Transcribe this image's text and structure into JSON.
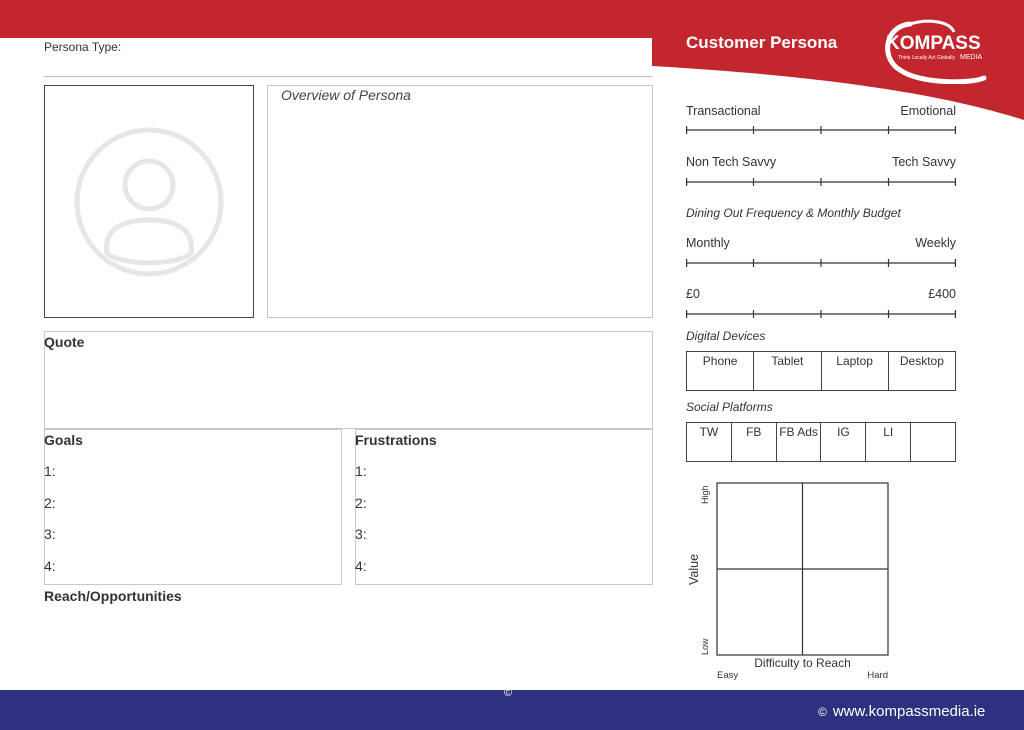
{
  "header": {
    "title": "Customer Persona",
    "logo_text": "KOMPASS",
    "logo_sub": "MEDIA",
    "logo_tagline": "Think Locally Act Globally"
  },
  "form": {
    "persona_type_label": "Persona Type:",
    "overview_label": "Overview of Persona",
    "quote_label": "Quote",
    "goals_label": "Goals",
    "frustrations_label": "Frustrations",
    "reach_label": "Reach/Opportunities",
    "numbers": [
      "1:",
      "2:",
      "3:",
      "4:"
    ]
  },
  "scales": {
    "transactional": "Transactional",
    "emotional": "Emotional",
    "non_tech": "Non Tech Savvy",
    "tech": "Tech Savvy",
    "dining_label": "Dining Out Frequency & Monthly Budget",
    "monthly": "Monthly",
    "weekly": "Weekly",
    "budget_min": "£0",
    "budget_max": "£400"
  },
  "devices": {
    "label": "Digital Devices",
    "items": [
      "Phone",
      "Tablet",
      "Laptop",
      "Desktop"
    ]
  },
  "social": {
    "label": "Social Platforms",
    "items": [
      "TW",
      "FB",
      "FB Ads",
      "IG",
      "LI",
      ""
    ]
  },
  "matrix": {
    "y_label": "Value",
    "y_high": "High",
    "y_low": "Low",
    "x_label": "Difficulty to Reach",
    "x_easy": "Easy",
    "x_hard": "Hard"
  },
  "footer": {
    "copyright": "©",
    "website": "www.kompassmedia.ie",
    "website_icon": "©"
  },
  "colors": {
    "brand_red": "#c1272d",
    "footer_blue": "#2e3180"
  }
}
